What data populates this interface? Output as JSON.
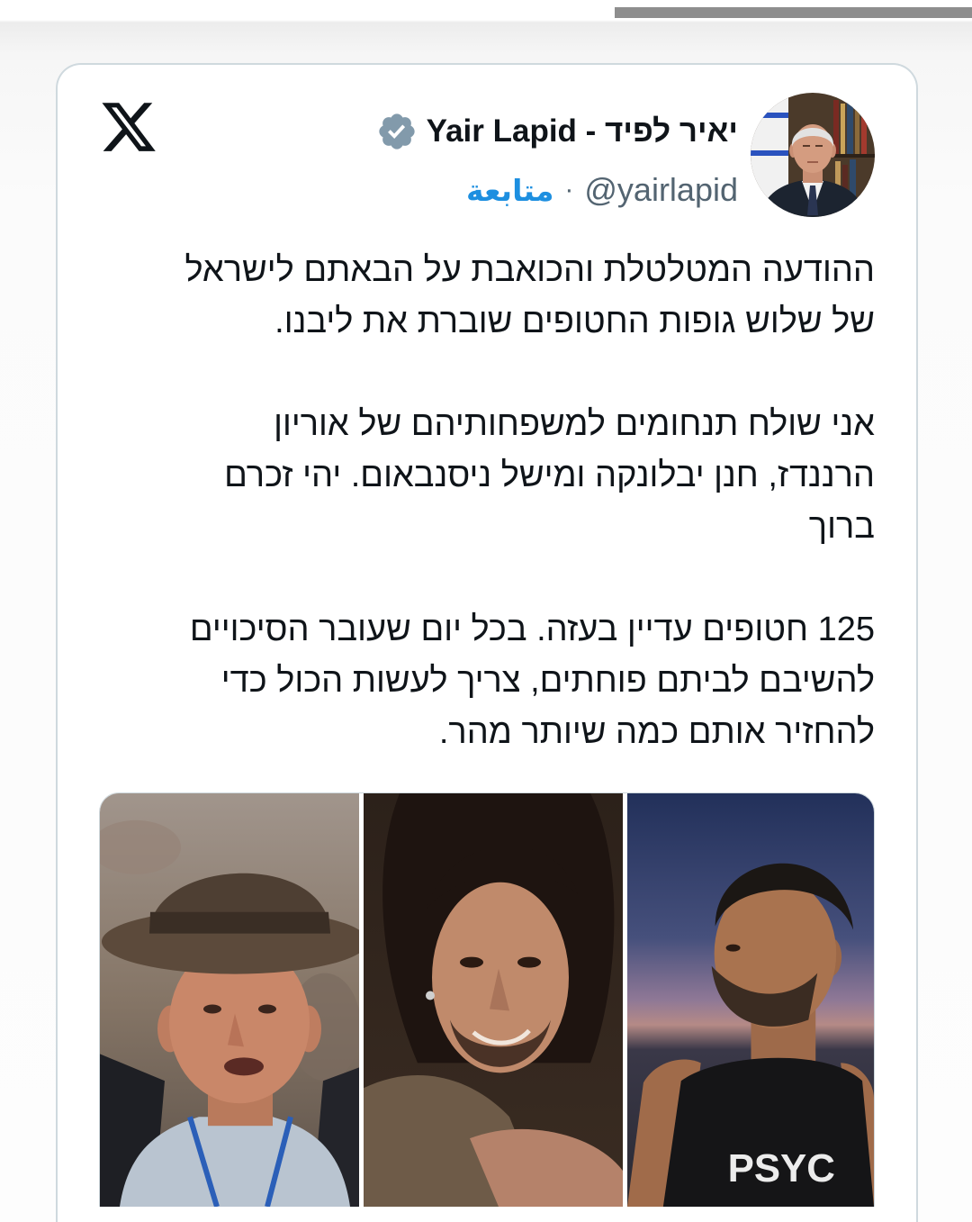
{
  "tweet": {
    "platform_icon": "x-logo-icon",
    "author": {
      "name": "יאיר לפיד - Yair Lapid",
      "verified_icon": "verified-badge-icon",
      "handle": "@yairlapid",
      "separator": "·",
      "follow_label": "متابعة"
    },
    "paragraphs": [
      [
        "ההודעה המטלטלת והכואבת על הבאתם לישראל",
        "של שלוש גופות החטופים שוברת את ליבנו."
      ],
      [
        "אני שולח תנחומים למשפחותיהם של אוריון",
        "הרננדז, חנן יבלונקה ומישל ניסנבאום. יהי זכרם",
        "ברוך"
      ],
      [
        "125 חטופים עדיין בעזה. בכל יום שעובר הסיכויים",
        "להשיבם לביתם פוחתים, צריך לעשות הכול כדי",
        "להחזיר אותם כמה שיותר מהר."
      ]
    ],
    "media": {
      "right_photo_shirt_text": "PSYC"
    }
  },
  "colors": {
    "text": "#0f1419",
    "handle": "#536471",
    "follow": "#1d8fe0",
    "badge": "#829aab",
    "border": "#cfd9de",
    "top_bar": "#8e8e8e"
  }
}
